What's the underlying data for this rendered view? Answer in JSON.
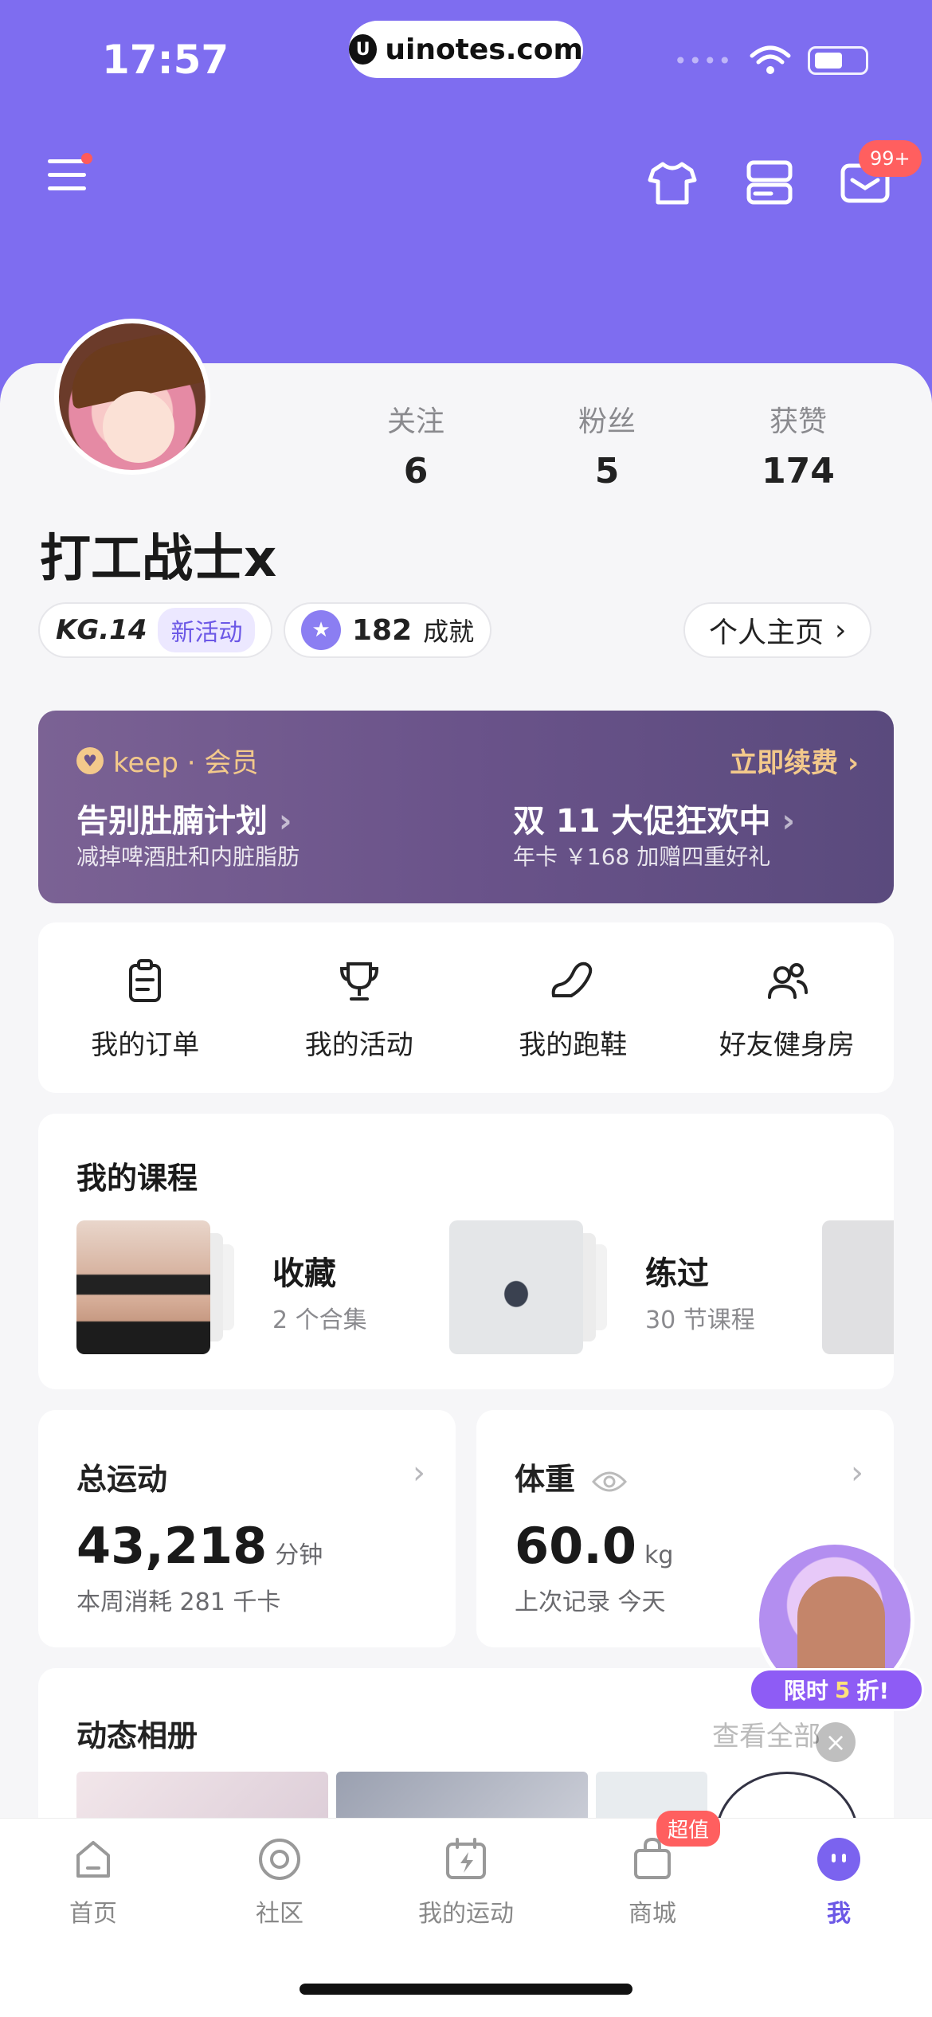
{
  "status_bar": {
    "time": "17:57",
    "url": "uinotes.com"
  },
  "header": {
    "message_badge": "99+"
  },
  "profile": {
    "username": "打工战士x",
    "stats": [
      {
        "label": "关注",
        "value": "6"
      },
      {
        "label": "粉丝",
        "value": "5"
      },
      {
        "label": "获赞",
        "value": "174"
      }
    ],
    "level": "KG.14",
    "level_tag": "新活动",
    "achievements_count": "182",
    "achievements_label": "成就",
    "homepage_label": "个人主页"
  },
  "vip": {
    "brand": "keep · 会员",
    "renew": "立即续费",
    "promo1_title": "告别肚腩计划",
    "promo1_sub": "减掉啤酒肚和内脏脂肪",
    "promo2_title": "双 11 大促狂欢中",
    "promo2_sub": "年卡 ￥168 加赠四重好礼"
  },
  "shortcuts": [
    {
      "label": "我的订单",
      "icon": "clipboard-icon"
    },
    {
      "label": "我的活动",
      "icon": "trophy-icon"
    },
    {
      "label": "我的跑鞋",
      "icon": "shoe-icon"
    },
    {
      "label": "好友健身房",
      "icon": "friends-icon"
    }
  ],
  "courses": {
    "title": "我的课程",
    "items": [
      {
        "title": "收藏",
        "sub": "2 个合集"
      },
      {
        "title": "练过",
        "sub": "30 节课程"
      }
    ]
  },
  "total_exercise": {
    "title": "总运动",
    "value": "43,218",
    "unit": "分钟",
    "sub": "本周消耗 281 千卡"
  },
  "weight": {
    "title": "体重",
    "value": "60.0",
    "unit": "kg",
    "sub": "上次记录 今天"
  },
  "album": {
    "title": "动态相册",
    "more": "查看全部"
  },
  "promo_float": {
    "prefix": "限时",
    "num": "5",
    "suffix": "折!"
  },
  "tabbar": [
    {
      "label": "首页",
      "icon": "home-icon"
    },
    {
      "label": "社区",
      "icon": "community-icon"
    },
    {
      "label": "我的运动",
      "icon": "calendar-bolt-icon"
    },
    {
      "label": "商城",
      "icon": "shop-bag-icon",
      "badge": "超值"
    },
    {
      "label": "我",
      "icon": "me-icon"
    }
  ]
}
